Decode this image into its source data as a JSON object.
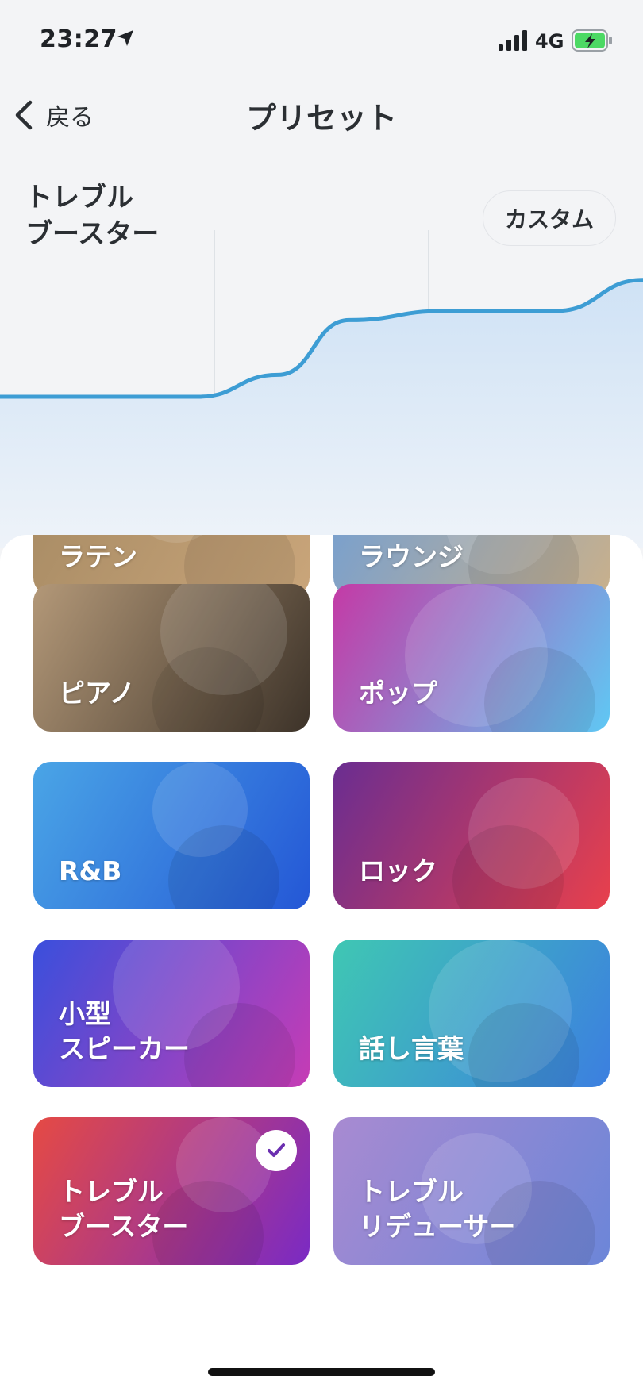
{
  "status_bar": {
    "time": "23:27",
    "network": "4G"
  },
  "nav": {
    "back_label": "戻る",
    "title": "プリセット"
  },
  "current_preset": {
    "line1": "トレブル",
    "line2": "ブースター"
  },
  "custom_button": {
    "label": "カスタム"
  },
  "eq": {
    "accent": "#3d9dd4",
    "levels": [
      0,
      0,
      1.2,
      4.2,
      4.7,
      4.7,
      6.4
    ]
  },
  "presets": [
    {
      "line1": "ラテン",
      "line2": "",
      "selected": false,
      "colors": [
        "#a68a63",
        "#c9a57a"
      ]
    },
    {
      "line1": "ラウンジ",
      "line2": "",
      "selected": false,
      "colors": [
        "#6f9ed6",
        "#c8b08c"
      ]
    },
    {
      "line1": "ピアノ",
      "line2": "",
      "selected": false,
      "colors": [
        "#b39878",
        "#3d3329"
      ]
    },
    {
      "line1": "ポップ",
      "line2": "",
      "selected": false,
      "colors": [
        "#c43aa6",
        "#5fc8f4"
      ]
    },
    {
      "line1": "R&B",
      "line2": "",
      "selected": false,
      "colors": [
        "#4aa5e6",
        "#2457d6"
      ]
    },
    {
      "line1": "ロック",
      "line2": "",
      "selected": false,
      "colors": [
        "#6a2d91",
        "#e8404c"
      ]
    },
    {
      "line1": "小型",
      "line2": "スピーカー",
      "selected": false,
      "colors": [
        "#3a4fdc",
        "#c63cb5"
      ]
    },
    {
      "line1": "話し言葉",
      "line2": "",
      "selected": false,
      "colors": [
        "#3fc7b3",
        "#3c7fe0"
      ]
    },
    {
      "line1": "トレブル",
      "line2": "ブースター",
      "selected": true,
      "colors": [
        "#e54a44",
        "#7a2ac4"
      ]
    },
    {
      "line1": "トレブル",
      "line2": "リデューサー",
      "selected": false,
      "colors": [
        "#a88ad1",
        "#6c86d8"
      ]
    }
  ]
}
